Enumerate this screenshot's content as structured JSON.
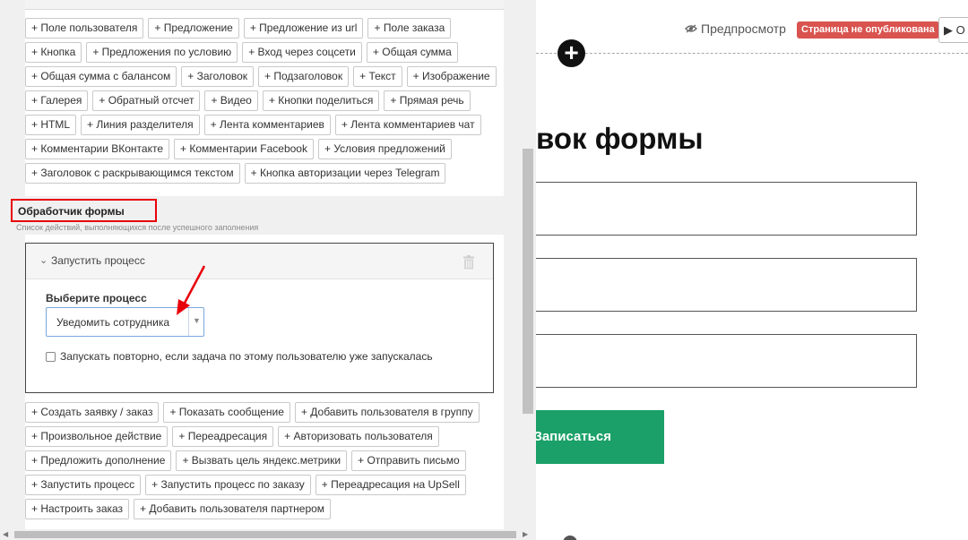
{
  "editor": {
    "field_buttons": [
      "+ Поле пользователя",
      "+ Предложение",
      "+ Предложение из url",
      "+ Поле заказа",
      "+ Кнопка",
      "+ Предложения по условию",
      "+ Вход через соцсети",
      "+ Общая сумма",
      "+ Общая сумма с балансом",
      "+ Заголовок",
      "+ Подзаголовок",
      "+ Текст",
      "+ Изображение",
      "+ Галерея",
      "+ Обратный отсчет",
      "+ Видео",
      "+ Кнопки поделиться",
      "+ Прямая речь",
      "+ HTML",
      "+ Линия разделителя",
      "+ Лента комментариев",
      "+ Лента комментариев чат",
      "+ Комментарии ВКонтакте",
      "+ Комментарии Facebook",
      "+ Условия предложений",
      "+ Заголовок с раскрывающимся текстом",
      "+ Кнопка авторизации через Telegram"
    ],
    "form_handler": {
      "title": "Обработчик формы",
      "subtitle": "Список действий, выполняющихся после успешного заполнения",
      "action": {
        "title": "Запустить процесс",
        "choose_label": "Выберите процесс",
        "selected_process": "Уведомить сотрудника",
        "repeat_label": "Запускать повторно, если задача по этому пользователю уже запускалась",
        "repeat_checked": false
      },
      "action_buttons": [
        "+ Создать заявку / заказ",
        "+ Показать сообщение",
        "+ Добавить пользователя в группу",
        "+ Произвольное действие",
        "+ Переадресация",
        "+ Авторизовать пользователя",
        "+ Предложить дополнение",
        "+ Вызвать цель яндекс.метрики",
        "+ Отправить письмо",
        "+ Запустить процесс",
        "+ Запустить процесс по заказу",
        "+ Переадресация на UpSell",
        "+ Настроить заказ",
        "+ Добавить пользователя партнером"
      ]
    }
  },
  "preview": {
    "preview_link": "Предпросмотр",
    "status_badge": "Страница не опубликована",
    "publish_button": "▶ О",
    "form_heading": "вок формы",
    "submit_label": "Записаться"
  },
  "colors": {
    "highlight": "#e8000b",
    "status_badge": "#d9534f",
    "submit": "#1aa068",
    "select_border": "#7aa7e0"
  }
}
